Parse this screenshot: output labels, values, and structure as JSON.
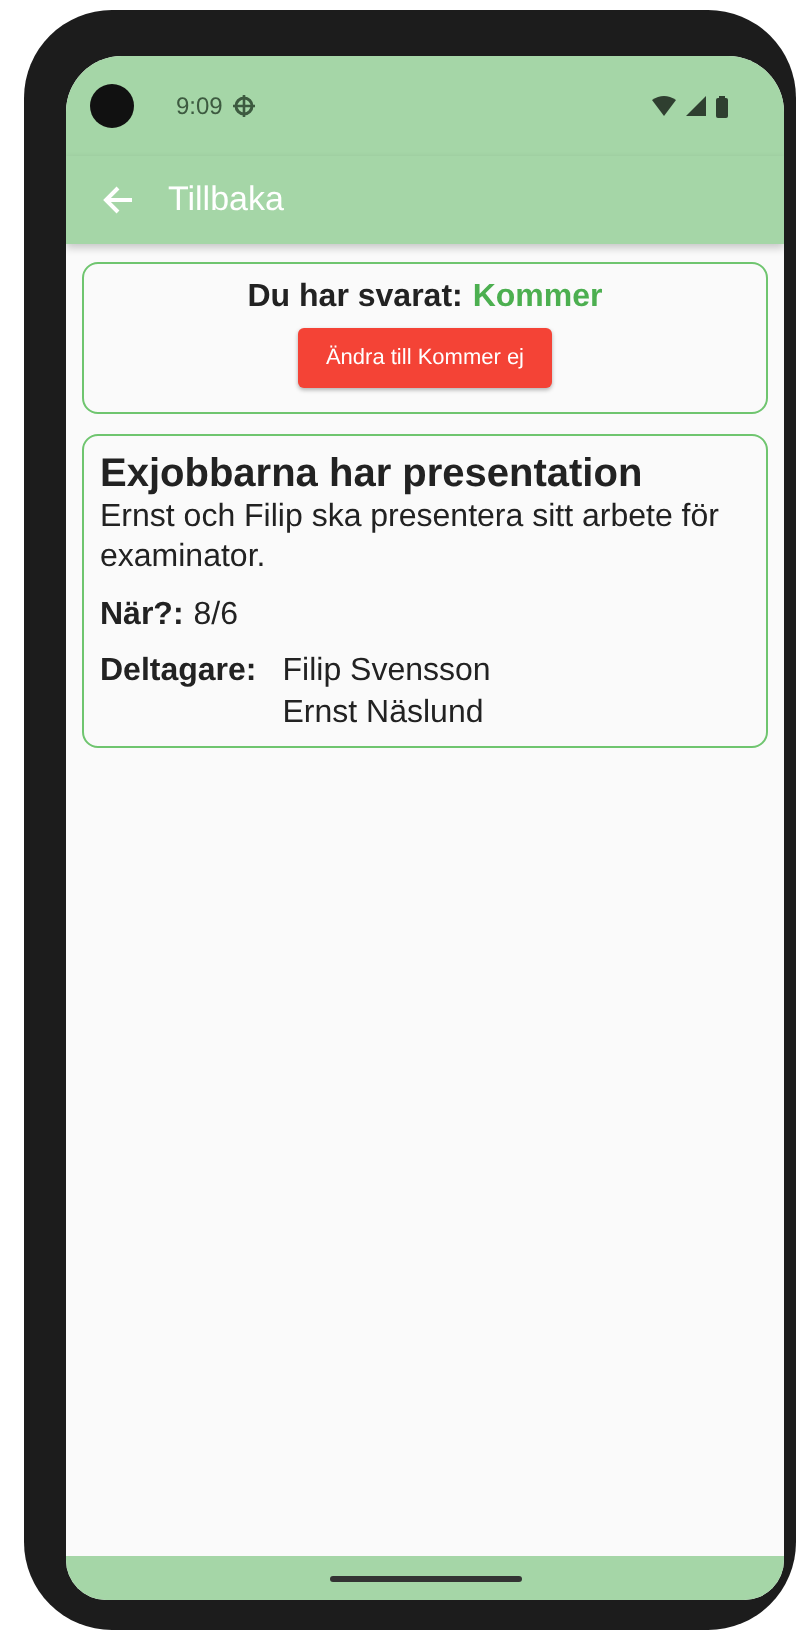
{
  "status_bar": {
    "time": "9:09"
  },
  "app_bar": {
    "title": "Tillbaka"
  },
  "response": {
    "label": "Du har svarat:",
    "value": "Kommer",
    "button": "Ändra till Kommer ej"
  },
  "event": {
    "title": "Exjobbarna har presentation",
    "description": "Ernst och Filip ska presentera sitt arbete för examinator.",
    "fields": [
      {
        "kind": "inline",
        "label": "När?:",
        "values": [
          "8/6"
        ]
      },
      {
        "kind": "list",
        "label": "Deltagare:",
        "values": [
          "Filip Svensson",
          "Ernst Näslund"
        ]
      }
    ]
  }
}
